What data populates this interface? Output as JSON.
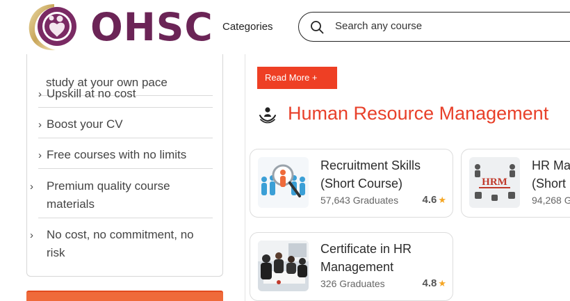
{
  "header": {
    "logo_text": "OHSC",
    "nav_categories": "Categories",
    "search_placeholder": "Search any course",
    "brand_color": "#6b2456"
  },
  "benefits": {
    "clipped_item": "study at your own pace",
    "items": [
      {
        "label": "Upskill at no cost"
      },
      {
        "label": "Boost your CV"
      },
      {
        "label": "Free courses with no limits"
      },
      {
        "label": "Premium quality course materials"
      },
      {
        "label": "No cost, no commitment, no risk"
      }
    ]
  },
  "main": {
    "read_more_label": "Read More +",
    "accent_color": "#ee3f24",
    "category_title": "Human Resource Management",
    "category_icon": "hands-with-person-icon",
    "courses": [
      {
        "title": "Recruitment Skills (Short Course)",
        "graduates": "57,643 Graduates",
        "rating": "4.6",
        "thumb_icon": "recruitment-figures-magnifier"
      },
      {
        "title": "HR Ma (Short",
        "graduates": "94,268 G",
        "rating": "",
        "thumb_icon": "hrm-diagram"
      },
      {
        "title": "Certificate in HR Management",
        "graduates": "326 Graduates",
        "rating": "4.8",
        "thumb_icon": "office-meeting-photo"
      }
    ]
  }
}
